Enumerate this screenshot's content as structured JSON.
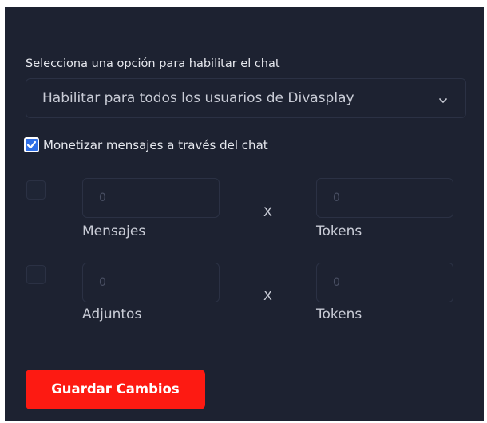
{
  "form": {
    "select_label": "Selecciona una opción para habilitar el chat",
    "select_value": "Habilitar para todos los usuarios de Divasplay",
    "monetize_label": "Monetizar mensajes a través del chat",
    "monetize_checked": true,
    "rows": [
      {
        "left_placeholder": "0",
        "left_label": "Mensajes",
        "times": "X",
        "right_placeholder": "0",
        "right_label": "Tokens"
      },
      {
        "left_placeholder": "0",
        "left_label": "Adjuntos",
        "times": "X",
        "right_placeholder": "0",
        "right_label": "Tokens"
      }
    ],
    "save_label": "Guardar Cambios"
  },
  "colors": {
    "background": "#1d2231",
    "border": "#2b3144",
    "accent_button": "#fd1a12",
    "checkbox_blue": "#2f6fe6"
  },
  "icons": {
    "dropdown": "chevron-down-icon",
    "checked": "checkmark-icon"
  }
}
